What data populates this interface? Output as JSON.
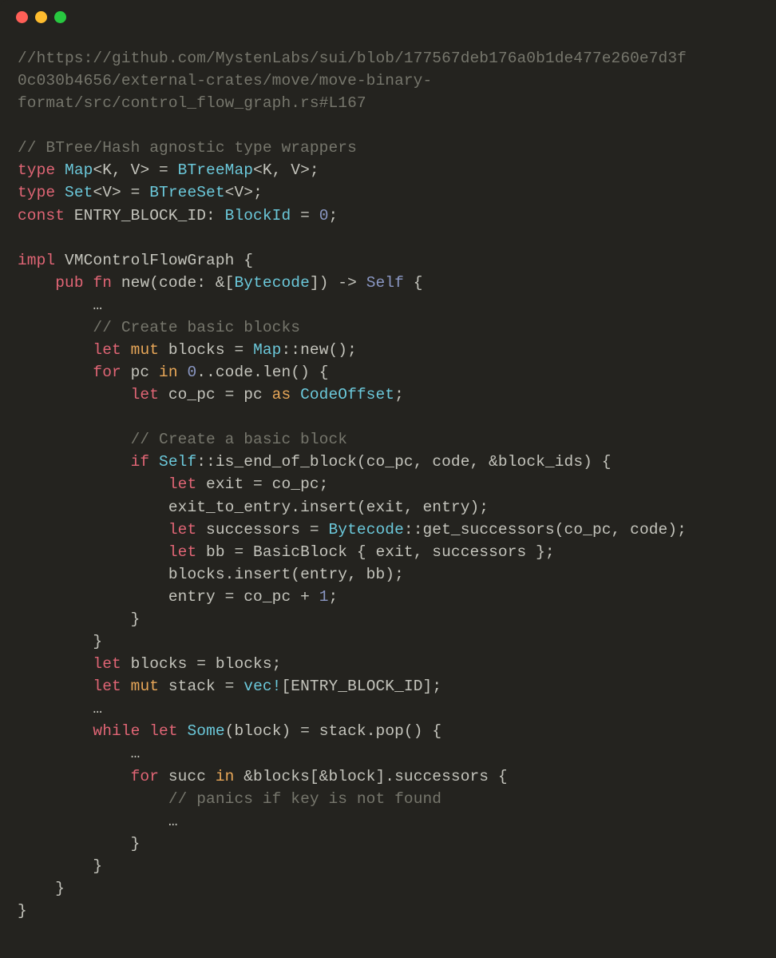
{
  "colors": {
    "bg": "#24231f",
    "comment": "#76766c",
    "keyword_red": "#e06575",
    "keyword_orange": "#e8a758",
    "type_cyan": "#6bc8da",
    "number_blue": "#8a97c3",
    "text": "#c7c7be",
    "dot_red": "#ff5f57",
    "dot_yellow": "#febc2e",
    "dot_green": "#28c840"
  },
  "code": {
    "url_c1": "//https://github.com/MystenLabs/sui/blob/177567deb176a0b1de477e260e7d3f",
    "url_c2": "0c030b4656/external-crates/move/move-binary-",
    "url_c3": "format/src/control_flow_graph.rs#L167",
    "wrap_comment": "// BTree/Hash agnostic type wrappers",
    "type_kw": "type",
    "map_name": "Map",
    "map_sig": "<K, V> = ",
    "btreemap": "BTreeMap",
    "map_tail": "<K, V>;",
    "set_name": "Set",
    "set_sig": "<V> = ",
    "btreeset": "BTreeSet",
    "set_tail": "<V>;",
    "const_kw": "const",
    "entry_block": " ENTRY_BLOCK_ID: ",
    "blockid": "BlockId",
    "eq0": " = ",
    "zero": "0",
    "semi": ";",
    "impl_kw": "impl",
    "vmgraph": " VMControlFlowGraph {",
    "pub_kw": "pub",
    "fn_kw": "fn",
    "new_fn": " new(code: &[",
    "bytecode": "Bytecode",
    "new_tail": "]) -> ",
    "self_t": "Self",
    "brace_open": " {",
    "ellipsis": "…",
    "create_blocks_c": "// Create basic blocks",
    "let_kw": "let",
    "mut_kw": "mut",
    "blocks_var": " blocks = ",
    "map_new": "::new();",
    "for_kw": "for",
    "pc_in": " pc ",
    "in_kw": "in",
    "range_start": " ",
    "zero2": "0",
    "range": "..code.len() {",
    "co_pc_decl": " co_pc = pc ",
    "as_kw": "as",
    "codeoffset": " CodeOffset",
    "create_block_c": "// Create a basic block",
    "if_kw": "if",
    "self_check": "::is_end_of_block(co_pc, code, &block_ids) {",
    "exit_decl": " exit = co_pc;",
    "exit_insert": "exit_to_entry.insert(exit, entry);",
    "succ_decl": " successors = ",
    "get_succ": "::get_successors(co_pc, code);",
    "bb_decl": " bb = BasicBlock { exit, successors };",
    "blocks_insert": "blocks.insert(entry, bb);",
    "entry_assign": "entry = co_pc + ",
    "one": "1",
    "brace_close": "}",
    "blocks_rebind": " blocks = blocks;",
    "stack_decl": " stack = ",
    "vec_macro": "vec!",
    "stack_init": "[ENTRY_BLOCK_ID];",
    "while_kw": "while",
    "some_t": "Some",
    "while_cond": "(block) = stack.pop() {",
    "for_succ": " succ ",
    "succ_iter": " &blocks[&block].successors {",
    "panic_c": "// panics if key is not found"
  }
}
